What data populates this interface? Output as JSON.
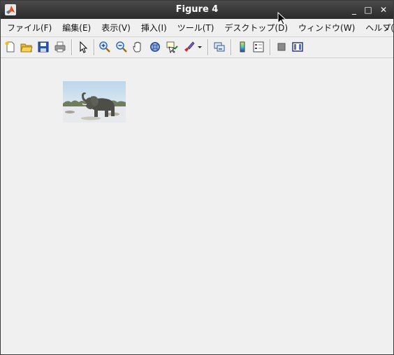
{
  "window": {
    "title": "Figure 4",
    "controls": {
      "minimize": "_",
      "maximize": "□",
      "close": "✕"
    }
  },
  "menu": {
    "items": [
      "ファイル(F)",
      "編集(E)",
      "表示(V)",
      "挿入(I)",
      "ツール(T)",
      "デスクトップ(D)",
      "ウィンドウ(W)",
      "ヘルプ(H)"
    ],
    "overflow": "↘"
  },
  "toolbar": {
    "icons": [
      "new-figure-icon",
      "open-file-icon",
      "save-icon",
      "print-icon",
      "edit-plot-arrow-icon",
      "zoom-in-icon",
      "zoom-out-icon",
      "pan-hand-icon",
      "rotate-3d-icon",
      "data-cursor-icon",
      "brush-icon",
      "brush-dropdown-icon",
      "link-plot-icon",
      "colorbar-icon",
      "legend-icon",
      "hide-plot-tools-icon",
      "show-plot-tools-icon"
    ]
  },
  "figure": {
    "image_subject": "elephant-photo"
  },
  "colors": {
    "titlebar": "#2b2b2b",
    "background": "#f0f0f0",
    "menu_text": "#111111"
  }
}
